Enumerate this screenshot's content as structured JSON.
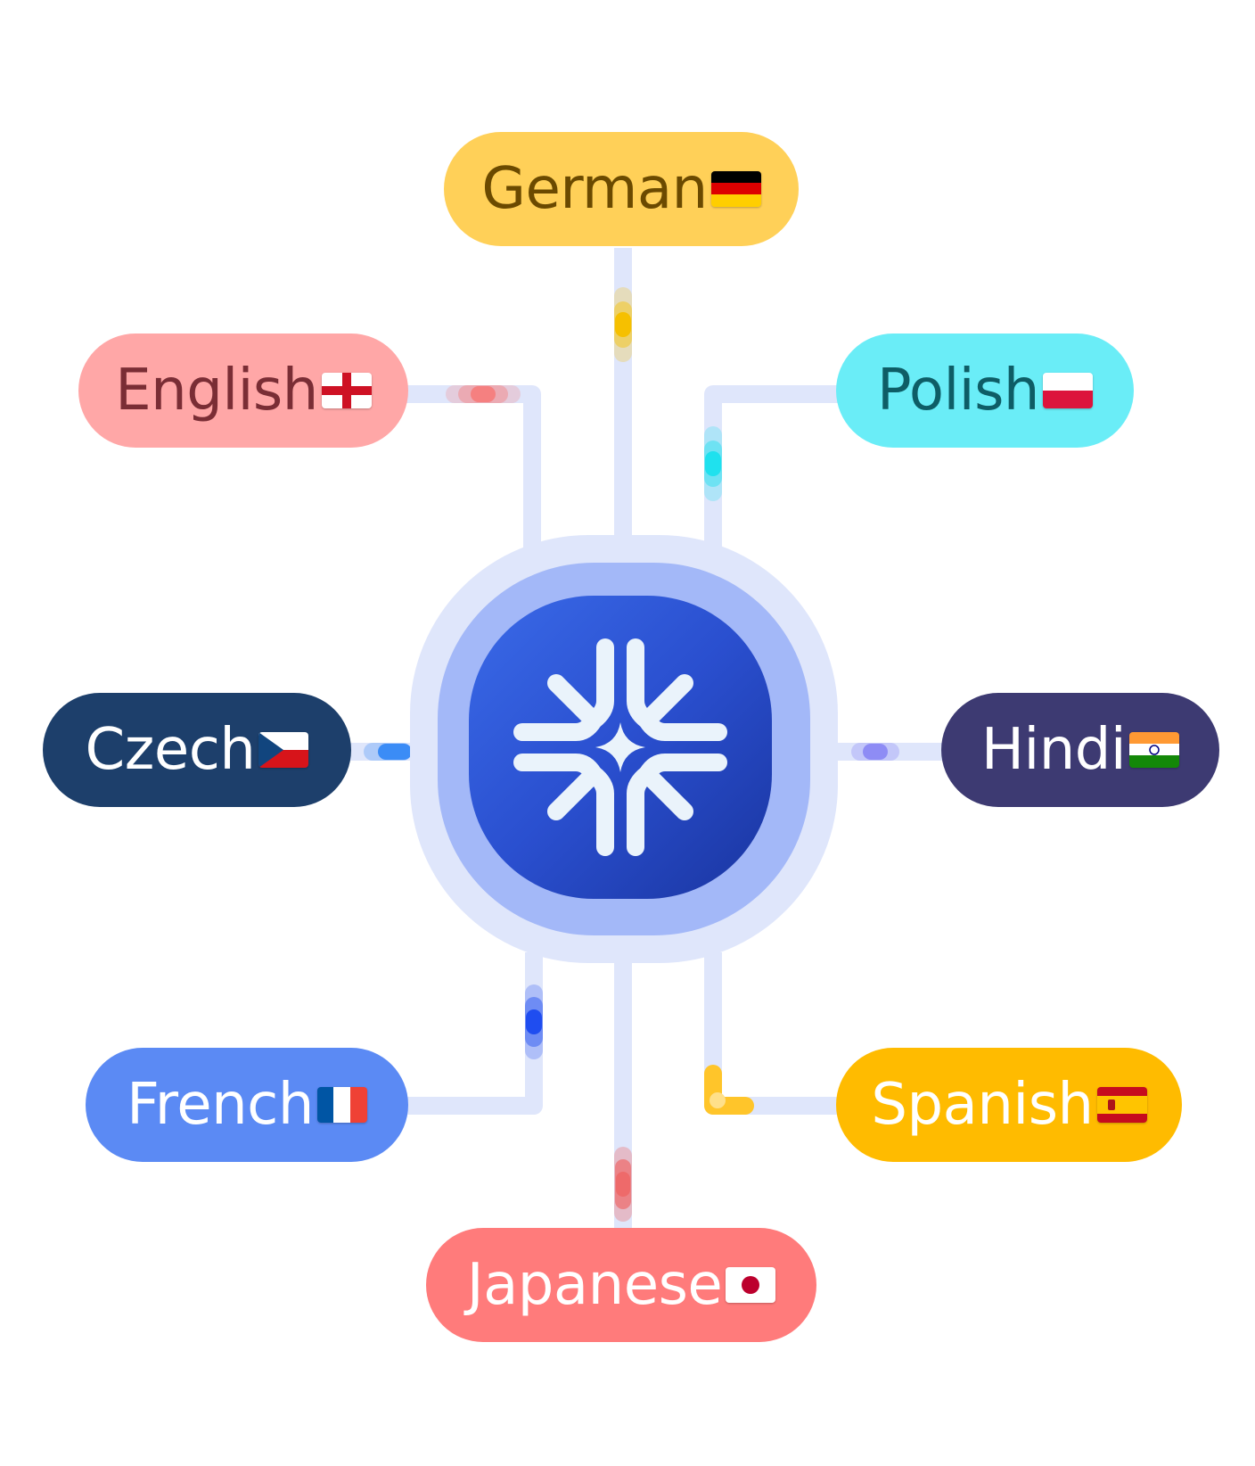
{
  "languages": [
    {
      "label": "German",
      "flag": "germany-flag",
      "bg": "#ffd058",
      "fg": "#6b4a00",
      "accent": "#f6c000"
    },
    {
      "label": "English",
      "flag": "england-flag",
      "bg": "#ffa7a7",
      "fg": "#7a2d35",
      "accent": "#f58080"
    },
    {
      "label": "Polish",
      "flag": "poland-flag",
      "bg": "#6aedf7",
      "fg": "#0e5d66",
      "accent": "#1fe1ee"
    },
    {
      "label": "Czech",
      "flag": "czech-flag",
      "bg": "#1d3f6b",
      "fg": "#ffffff",
      "accent": "#3b8cf6"
    },
    {
      "label": "Hindi",
      "flag": "india-flag",
      "bg": "#3d3a72",
      "fg": "#ffffff",
      "accent": "#8e8cf5"
    },
    {
      "label": "French",
      "flag": "france-flag",
      "bg": "#5b8af4",
      "fg": "#ffffff",
      "accent": "#1f4df0"
    },
    {
      "label": "Spanish",
      "flag": "spain-flag",
      "bg": "#ffbb00",
      "fg": "#ffffff",
      "accent": "#ffc52a"
    },
    {
      "label": "Japanese",
      "flag": "japan-flag",
      "bg": "#ff7b7b",
      "fg": "#ffffff",
      "accent": "#ee6a6a"
    }
  ],
  "hub": {
    "icon": "snowflake-sparkle-icon"
  },
  "colors": {
    "connector": "#dfe6fb",
    "hub_ring": "#a3b8f8",
    "icon": "#eaf3fb"
  }
}
